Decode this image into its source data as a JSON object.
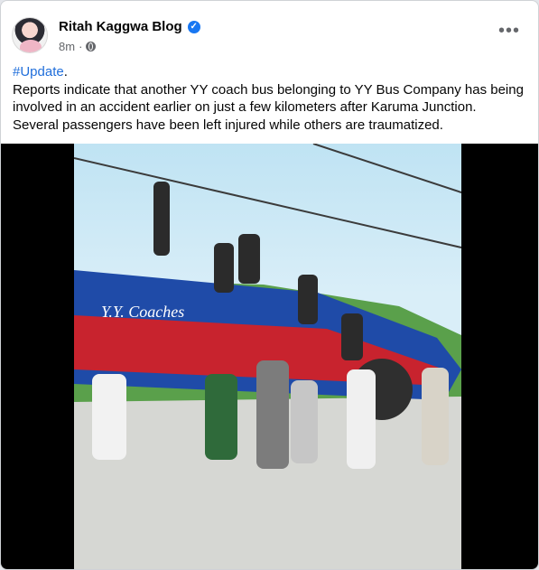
{
  "post": {
    "author": "Ritah Kaggwa Blog",
    "verified_icon": "verified-badge-icon",
    "time": "8m",
    "privacy_icon": "globe-icon",
    "more_icon": "more-icon",
    "hashtag": "#Update",
    "hashtag_suffix": ".",
    "body_lines": [
      "Reports indicate that another YY coach bus belonging to YY Bus Company has being",
      "involved in an accident earlier on just a few kilometers after Karuma Junction.",
      "Several passengers have been left injured while others are traumatized."
    ],
    "image": {
      "bus_text": "Y.Y. Coaches"
    }
  }
}
